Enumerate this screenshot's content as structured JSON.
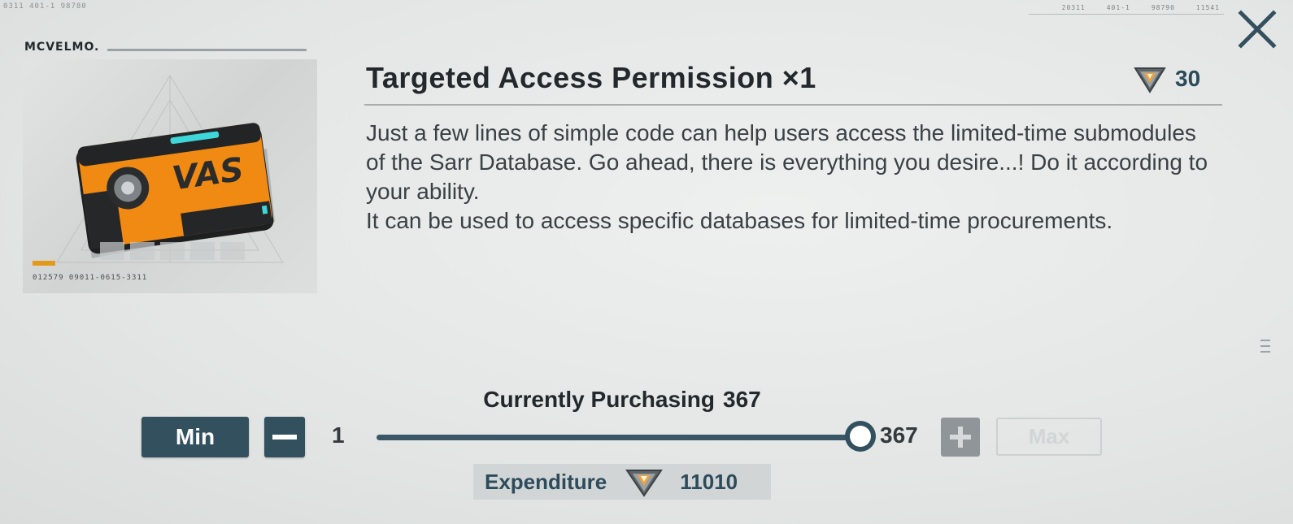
{
  "deco": {
    "top_left_code": "0311   401-1   98780",
    "top_right_codes": [
      "20311",
      "401-1",
      "98790",
      "11541"
    ]
  },
  "brand": {
    "logo_text": "MCVELMO."
  },
  "item": {
    "image_code": "012579  09011-0615-3311",
    "card_logo": "VAS",
    "title": "Targeted Access Permission ×1",
    "price": "30",
    "price_icon": "diamond-currency-icon",
    "description": [
      "Just a few lines of simple code can help users access the limited-time submodules of the Sarr Database. Go ahead, there is everything you desire...! Do it according to your ability.",
      "It can be used to access specific databases for limited-time procurements."
    ]
  },
  "purchase": {
    "label": "Currently Purchasing",
    "quantity": "367",
    "min_label": "Min",
    "max_label": "Max",
    "min_value": "1",
    "max_value": "367",
    "slider_fraction": 1.0
  },
  "expenditure": {
    "label": "Expenditure",
    "value": "11010",
    "icon": "diamond-currency-icon"
  },
  "colors": {
    "accent": "#33505f",
    "orange": "#e39a1a",
    "background": "#e3e6e5"
  }
}
